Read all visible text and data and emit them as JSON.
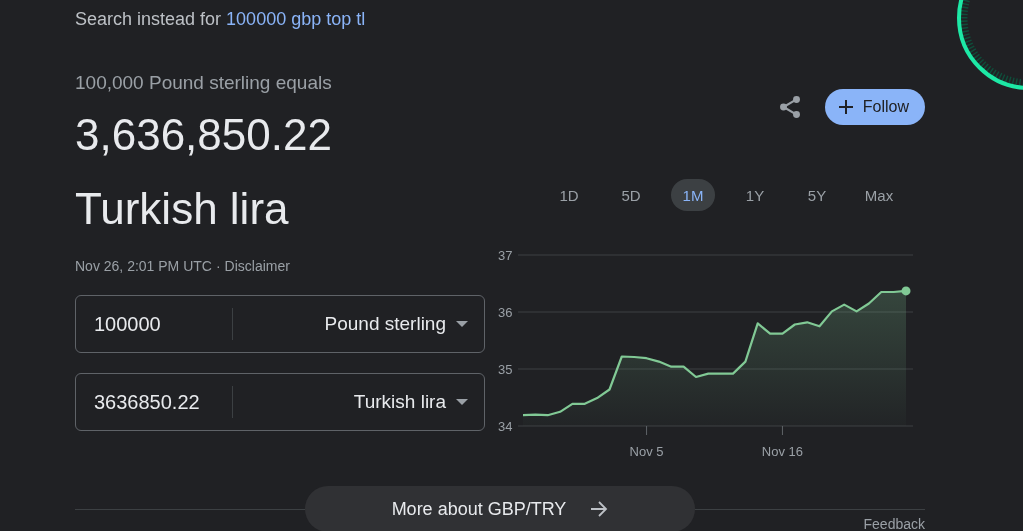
{
  "spelling": {
    "instead_label": "Search instead for",
    "instead_query": "100000 gbp top tl"
  },
  "converter": {
    "subtitle": "100,000 Pound sterling equals",
    "amount": "3,636,850.22",
    "currency": "Turkish lira",
    "timestamp": "Nov 26, 2:01 PM UTC",
    "separator": "·",
    "disclaimer": "Disclaimer",
    "rows": [
      {
        "value": "100000",
        "unit": "Pound sterling"
      },
      {
        "value": "3636850.22",
        "unit": "Turkish lira"
      }
    ]
  },
  "actions": {
    "follow": "Follow"
  },
  "ranges": [
    {
      "label": "1D",
      "selected": false
    },
    {
      "label": "5D",
      "selected": false
    },
    {
      "label": "1M",
      "selected": true
    },
    {
      "label": "1Y",
      "selected": false
    },
    {
      "label": "5Y",
      "selected": false
    },
    {
      "label": "Max",
      "selected": false
    }
  ],
  "chart_data": {
    "type": "area",
    "categories": [
      null,
      null,
      null,
      null,
      null,
      null,
      null,
      null,
      null,
      null,
      "Nov 5",
      null,
      null,
      null,
      null,
      null,
      null,
      null,
      null,
      null,
      null,
      "Nov 16",
      null,
      null,
      null,
      null,
      null,
      null,
      null,
      null,
      null,
      null
    ],
    "series": [
      {
        "color": "#81c995",
        "values": [
          34.19,
          34.2,
          34.19,
          34.25,
          34.39,
          34.39,
          34.49,
          34.64,
          35.22,
          35.21,
          35.19,
          35.13,
          35.04,
          35.04,
          34.86,
          34.92,
          34.92,
          34.92,
          35.13,
          35.8,
          35.62,
          35.62,
          35.78,
          35.82,
          35.75,
          36.01,
          36.13,
          36.01,
          36.15,
          36.35,
          36.35,
          36.37
        ]
      }
    ],
    "ylim": [
      34,
      37
    ],
    "yticks": [
      34,
      35,
      36,
      37
    ]
  },
  "more_button": "More about GBP/TRY",
  "feedback": "Feedback"
}
